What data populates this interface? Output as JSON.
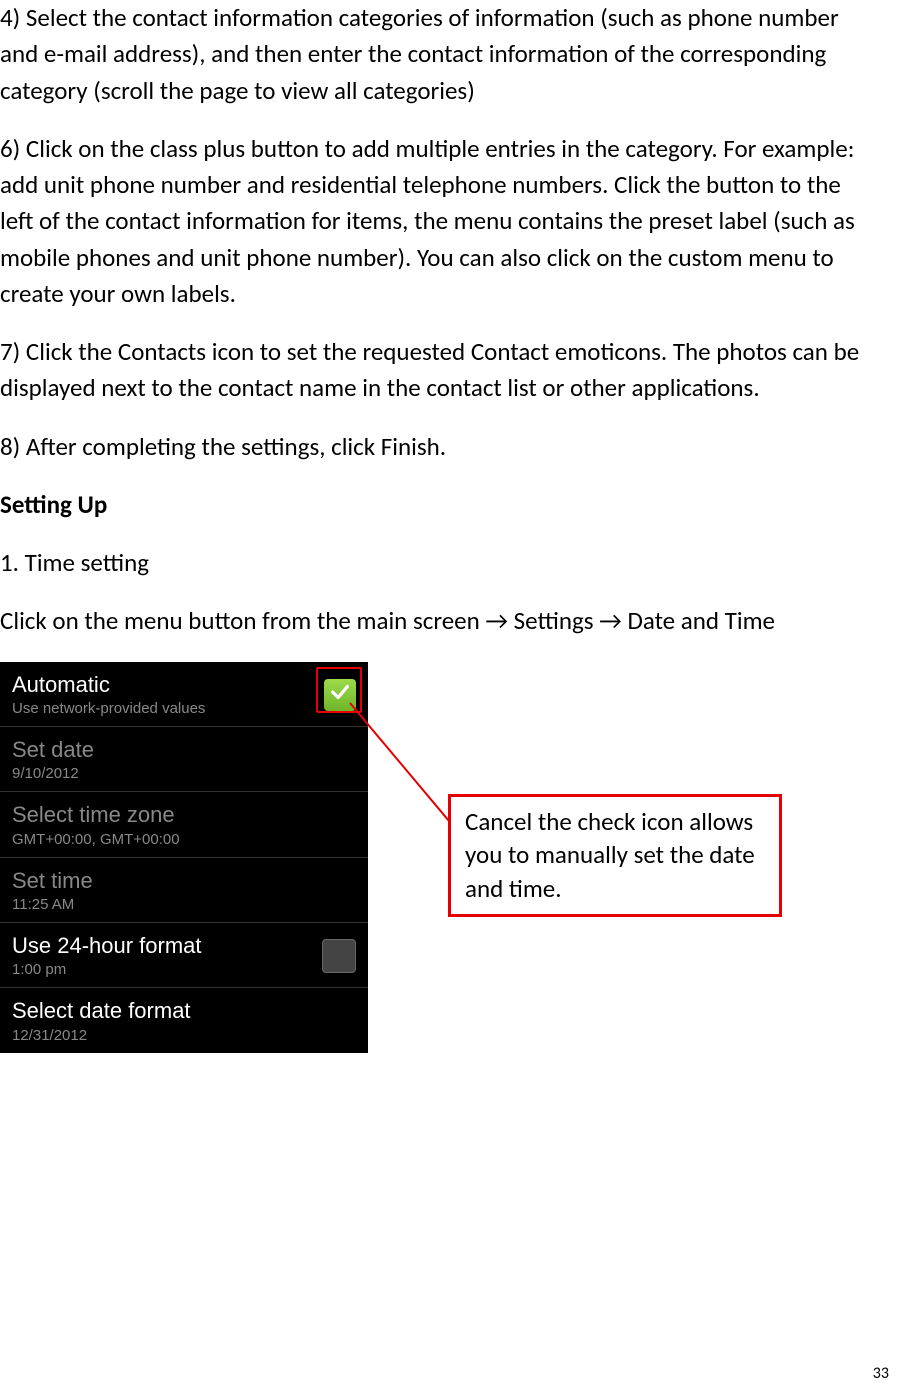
{
  "paragraphs": {
    "p4": "4) Select the contact information categories of information (such as phone number and e-mail address), and then enter the contact information of the corresponding category (scroll the page to view all categories)",
    "p6": "6) Click on the class plus button to add multiple entries in the category. For example: add unit phone number and residential telephone numbers. Click the button to the left of the contact information for items, the menu contains the preset label (such as mobile phones and unit phone number). You can also click on the custom menu to create your own labels.",
    "p7": "7) Click the Contacts icon to set the requested Contact emoticons. The photos can be displayed next to the contact name in the contact list or other applications.",
    "p8": "8) After completing the settings, click Finish.",
    "heading": "Setting Up",
    "sub1": "1. Time setting",
    "instr": "Click on the menu button from the main screen → Settings → Date and Time"
  },
  "phone": {
    "rows": [
      {
        "title": "Automatic",
        "sub": "Use network-provided values",
        "white": true,
        "checkbox": "checked"
      },
      {
        "title": "Set date",
        "sub": "9/10/2012",
        "white": false
      },
      {
        "title": "Select time zone",
        "sub": "GMT+00:00, GMT+00:00",
        "white": false
      },
      {
        "title": "Set time",
        "sub": "11:25 AM",
        "white": false
      },
      {
        "title": "Use 24-hour format",
        "sub": "1:00 pm",
        "white": true,
        "checkbox": "unchecked"
      },
      {
        "title": "Select date format",
        "sub": "12/31/2012",
        "white": true
      }
    ]
  },
  "callout": "Cancel the check icon allows you to manually set the date and time.",
  "page_number": "33"
}
